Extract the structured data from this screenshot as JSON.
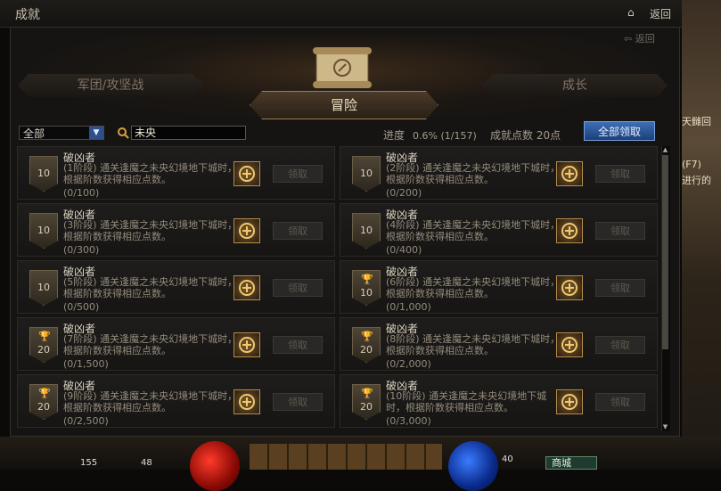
{
  "window": {
    "title": "成就",
    "home_icon": "home-icon",
    "back_label": "返回"
  },
  "panel": {
    "back_label": "返回"
  },
  "tabs": {
    "left": "军团/攻坚战",
    "active": "冒险",
    "right": "成长"
  },
  "filter": {
    "dropdown_value": "全部",
    "search_value": "未央"
  },
  "stats": {
    "progress_label": "进度",
    "progress_value": "0.6% (1/157)",
    "points_label": "成就点数 20点"
  },
  "claim_all_label": "全部领取",
  "claim_label": "领取",
  "achievements": [
    {
      "title": "破凶者",
      "desc": "(1阶段) 通关逢魔之未央幻境地下城时，根据阶数获得相应点数。",
      "progress": "(0/100)",
      "badge": "10",
      "cup": false
    },
    {
      "title": "破凶者",
      "desc": "(2阶段) 通关逢魔之未央幻境地下城时，根据阶数获得相应点数。",
      "progress": "(0/200)",
      "badge": "10",
      "cup": false
    },
    {
      "title": "破凶者",
      "desc": "(3阶段) 通关逢魔之未央幻境地下城时，根据阶数获得相应点数。",
      "progress": "(0/300)",
      "badge": "10",
      "cup": false
    },
    {
      "title": "破凶者",
      "desc": "(4阶段) 通关逢魔之未央幻境地下城时，根据阶数获得相应点数。",
      "progress": "(0/400)",
      "badge": "10",
      "cup": false
    },
    {
      "title": "破凶者",
      "desc": "(5阶段) 通关逢魔之未央幻境地下城时，根据阶数获得相应点数。",
      "progress": "(0/500)",
      "badge": "10",
      "cup": false
    },
    {
      "title": "破凶者",
      "desc": "(6阶段) 通关逢魔之未央幻境地下城时，根据阶数获得相应点数。",
      "progress": "(0/1,000)",
      "badge": "10",
      "cup": true
    },
    {
      "title": "破凶者",
      "desc": "(7阶段) 通关逢魔之未央幻境地下城时，根据阶数获得相应点数。",
      "progress": "(0/1,500)",
      "badge": "20",
      "cup": true
    },
    {
      "title": "破凶者",
      "desc": "(8阶段) 通关逢魔之未央幻境地下城时，根据阶数获得相应点数。",
      "progress": "(0/2,000)",
      "badge": "20",
      "cup": true
    },
    {
      "title": "破凶者",
      "desc": "(9阶段) 通关逢魔之未央幻境地下城时，根据阶数获得相应点数。",
      "progress": "(0/2,500)",
      "badge": "20",
      "cup": true
    },
    {
      "title": "破凶者",
      "desc": "(10阶段) 通关逢魔之未央幻境地下城时，根据阶数获得相应点数。",
      "progress": "(0/3,000)",
      "badge": "20",
      "cup": true
    }
  ],
  "side_text": [
    "天雠回",
    "(F7)",
    "进行的"
  ],
  "hud": {
    "num1": "155",
    "num2": "48",
    "num3": "40",
    "shop": "商城"
  }
}
